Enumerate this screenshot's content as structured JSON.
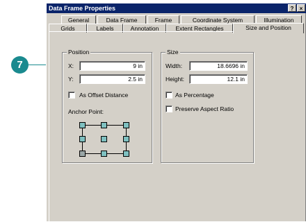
{
  "callout": {
    "number": "7"
  },
  "window": {
    "title": "Data Frame Properties",
    "help_label": "?",
    "close_label": "×"
  },
  "tabs_back": [
    "General",
    "Data Frame",
    "Frame",
    "Coordinate System",
    "Illumination"
  ],
  "tabs_front": [
    "Grids",
    "Labels",
    "Annotation",
    "Extent Rectangles",
    "Size and Position"
  ],
  "active_tab": "Size and Position",
  "position": {
    "group_title": "Position",
    "x_label": "X:",
    "x_value": "9 in",
    "y_label": "Y:",
    "y_value": "2.5 in",
    "offset_checkbox_label": "As Offset Distance",
    "offset_checked": false,
    "anchor_label": "Anchor Point:",
    "anchor_selected": "bottom-left"
  },
  "size": {
    "group_title": "Size",
    "width_label": "Width:",
    "width_value": "18.6696 in",
    "height_label": "Height:",
    "height_value": "12.1 in",
    "percentage_label": "As Percentage",
    "percentage_checked": false,
    "aspect_label": "Preserve Aspect Ratio",
    "aspect_checked": false
  },
  "colors": {
    "title_bar": "#0a246a",
    "dialog_face": "#d4d0c8",
    "callout": "#1a8a8f",
    "anchor": "#7fc0c0"
  }
}
